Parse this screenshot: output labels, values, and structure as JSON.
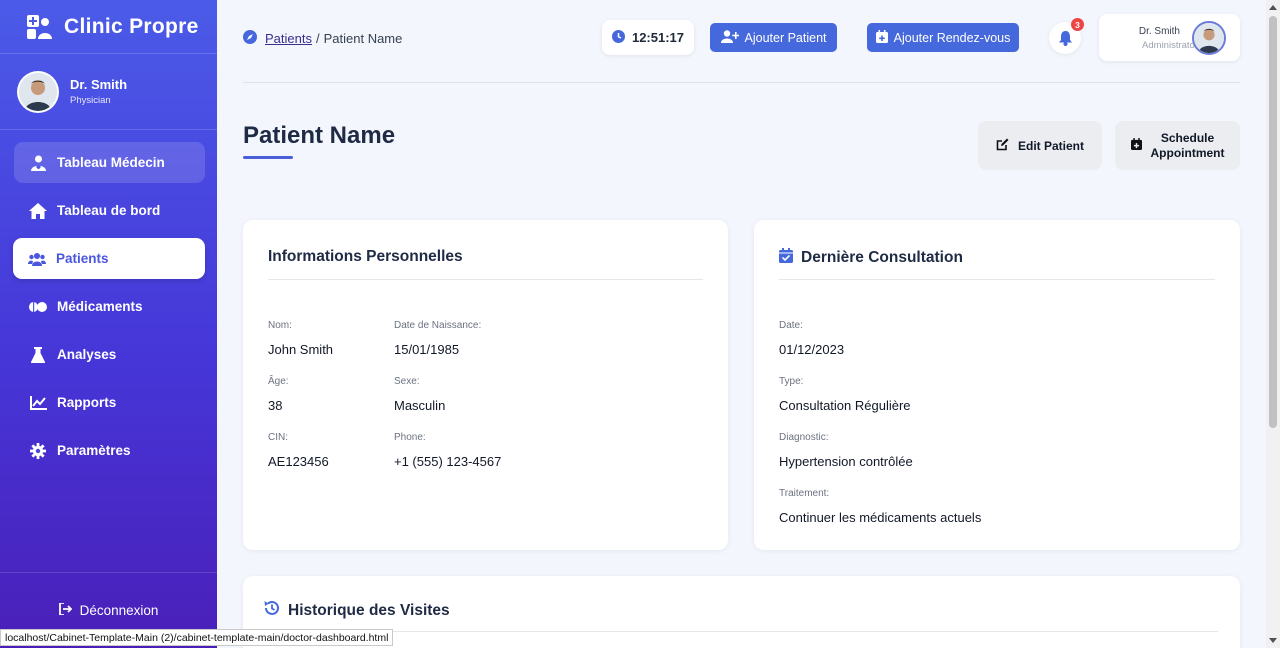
{
  "brand": {
    "name": "Clinic Propre"
  },
  "sidebar_profile": {
    "name": "Dr. Smith",
    "role": "Physician"
  },
  "nav": [
    {
      "label": "Tableau Médecin",
      "icon": "user-doctor-icon"
    },
    {
      "label": "Tableau de bord",
      "icon": "home-icon"
    },
    {
      "label": "Patients",
      "icon": "users-icon"
    },
    {
      "label": "Médicaments",
      "icon": "pills-icon"
    },
    {
      "label": "Analyses",
      "icon": "flask-icon"
    },
    {
      "label": "Rapports",
      "icon": "chart-line-icon"
    },
    {
      "label": "Paramètres",
      "icon": "gear-icon"
    }
  ],
  "logout_label": "Déconnexion",
  "breadcrumb": {
    "parent": "Patients",
    "separator": "/",
    "current": "Patient Name"
  },
  "clock": "12:51:17",
  "buttons": {
    "add_patient": "Ajouter Patient",
    "add_appointment": "Ajouter Rendez-vous",
    "edit_patient": "Edit Patient",
    "schedule_line1": "Schedule",
    "schedule_line2": "Appointment"
  },
  "notifications": {
    "count": "3"
  },
  "user": {
    "name": "Dr. Smith",
    "role": "Administrator"
  },
  "page_title": "Patient Name",
  "personal": {
    "title": "Informations Personnelles",
    "fields": [
      {
        "label": "Nom:",
        "value": "John Smith"
      },
      {
        "label": "Date de Naissance:",
        "value": "15/01/1985"
      },
      {
        "label": "Âge:",
        "value": "38"
      },
      {
        "label": "Sexe:",
        "value": "Masculin"
      },
      {
        "label": "CIN:",
        "value": "AE123456"
      },
      {
        "label": "Phone:",
        "value": "+1 (555) 123-4567"
      }
    ]
  },
  "consultation": {
    "title": "Dernière Consultation",
    "fields": [
      {
        "label": "Date:",
        "value": "01/12/2023"
      },
      {
        "label": "Type:",
        "value": "Consultation Régulière"
      },
      {
        "label": "Diagnostic:",
        "value": "Hypertension contrôlée"
      },
      {
        "label": "Traitement:",
        "value": "Continuer les médicaments actuels"
      }
    ]
  },
  "history": {
    "title": "Historique des Visites"
  },
  "status_url": "localhost/Cabinet-Template-Main (2)/cabinet-template-main/doctor-dashboard.html",
  "colors": {
    "primary": "#4568dc",
    "sidebar_top": "#4b5be8",
    "sidebar_bottom": "#4a1fb8",
    "badge": "#ef4444"
  }
}
